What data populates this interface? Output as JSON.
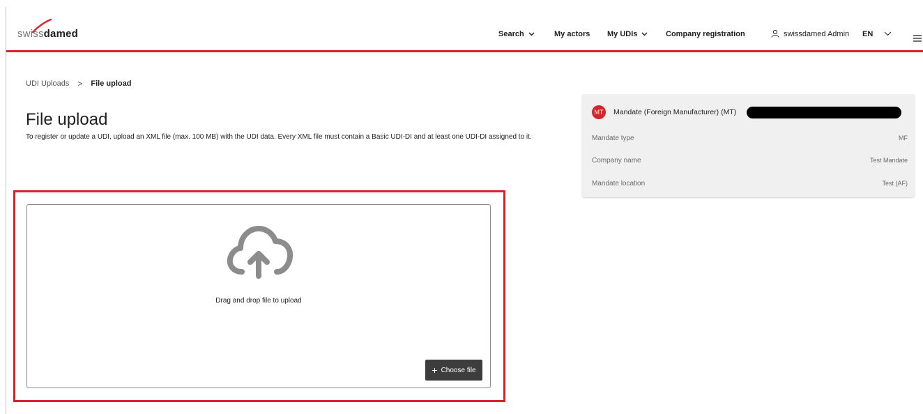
{
  "logo": {
    "prefix": "swiss",
    "suffix": "damed"
  },
  "nav": {
    "search": "Search",
    "actors": "My actors",
    "udis": "My UDIs",
    "company": "Company registration",
    "user": "swissdamed Admin",
    "lang": "EN"
  },
  "breadcrumb": {
    "parent": "UDI Uploads",
    "separator": ">",
    "current": "File upload"
  },
  "page": {
    "title": "File upload",
    "description": "To register or update a UDI, upload an XML file (max. 100 MB) with the UDI data. Every XML file must contain a Basic UDI-DI and at least one UDI-DI assigned to it."
  },
  "mandate": {
    "badge": "MT",
    "title": "Mandate (Foreign Manufacturer) (MT)",
    "rows": [
      {
        "label": "Mandate type",
        "value": "MF"
      },
      {
        "label": "Company name",
        "value": "Test Mandate"
      },
      {
        "label": "Mandate location",
        "value": "Test (AF)"
      }
    ]
  },
  "upload": {
    "drop_text": "Drag and drop file to upload",
    "choose_label": "Choose file",
    "choose_icon": "+"
  },
  "colors": {
    "accent": "#d8232a",
    "button": "#3d3d3d",
    "card": "#f0f0f0",
    "icon": "#8c8c8c"
  },
  "icons": [
    "chevron-down-icon",
    "user-icon",
    "hamburger-menu-icon",
    "cloud-upload-icon",
    "plus-icon"
  ]
}
